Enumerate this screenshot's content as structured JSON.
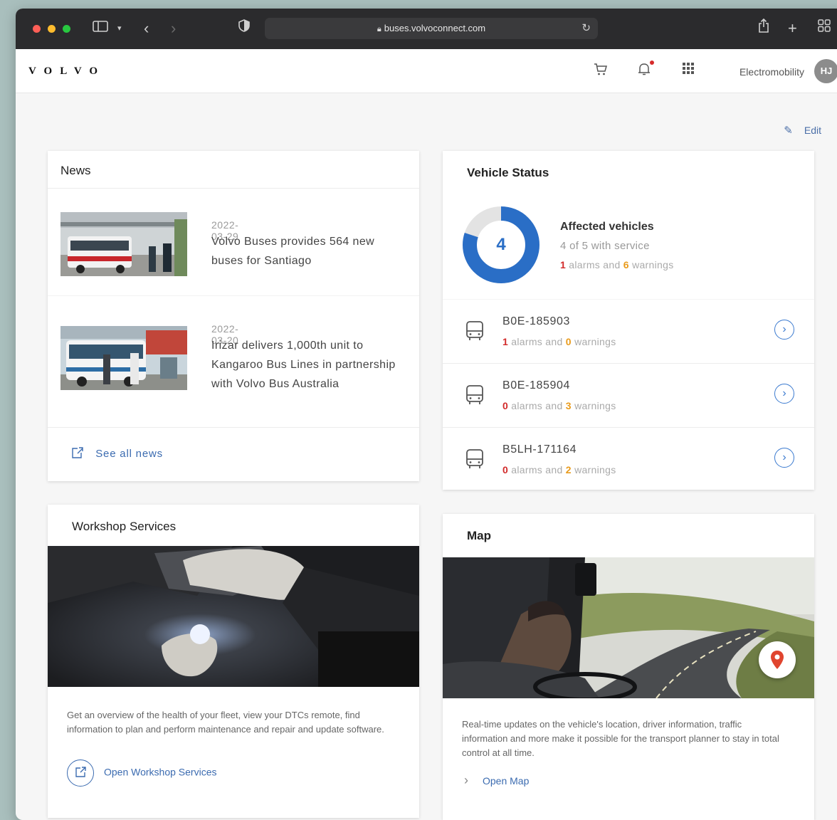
{
  "browser": {
    "url": "buses.volvoconnect.com"
  },
  "header": {
    "logo": "VOLVO",
    "workspace": "Electromobility",
    "avatar_initials": "HJ",
    "edit_label": "Edit"
  },
  "news": {
    "title": "News",
    "items": [
      {
        "date": "2022-03-29",
        "text": "Volvo Buses provides 564 new buses for Santiago"
      },
      {
        "date": "2022-03-20",
        "text": "Irizar delivers 1,000th unit to Kangaroo Bus Lines in partnership with Volvo Bus Australia"
      }
    ],
    "see_all": "See all news"
  },
  "vehicle_status": {
    "title": "Vehicle Status",
    "donut_value": 4,
    "donut_total": 5,
    "affected_title": "Affected vehicles",
    "affected_sub": "4 of 5 with service",
    "summary": {
      "alarms": "1",
      "alarms_text": "alarms and",
      "warnings": "6",
      "warnings_text": "warnings"
    },
    "vehicles": [
      {
        "id": "B0E-185903",
        "alarms": "1",
        "alarms_text": "alarms and",
        "warnings": "0",
        "warnings_text": "warnings"
      },
      {
        "id": "B0E-185904",
        "alarms": "0",
        "alarms_text": "alarms and",
        "warnings": "3",
        "warnings_text": "warnings"
      },
      {
        "id": "B5LH-171164",
        "alarms": "0",
        "alarms_text": "alarms and",
        "warnings": "2",
        "warnings_text": "warnings"
      }
    ]
  },
  "workshop": {
    "title": "Workshop Services",
    "description": "Get an overview of the health of your fleet, view your DTCs remote, find information to plan and perform maintenance and repair and update software.",
    "link": "Open Workshop Services"
  },
  "map": {
    "title": "Map",
    "description": "Real-time updates on the vehicle's location, driver information, traffic information and more make it possible for the transport planner to stay in total control at all time.",
    "link": "Open Map"
  },
  "colors": {
    "accent": "#2a6ec6",
    "alarm": "#d22b2b",
    "warning": "#e99b1c"
  }
}
